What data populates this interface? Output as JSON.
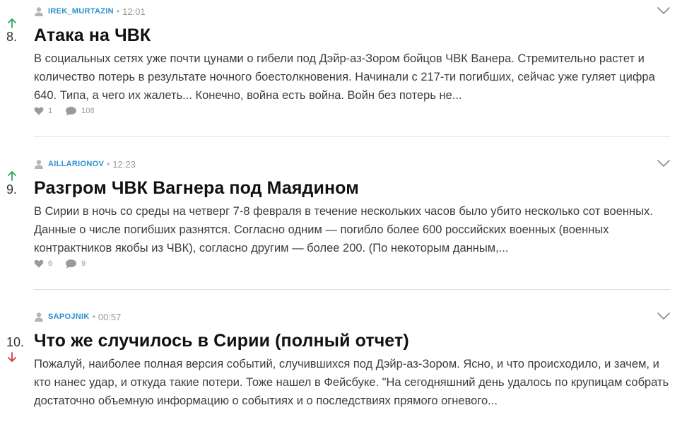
{
  "posts": [
    {
      "rank": "8.",
      "vote": "up",
      "author": "IREK_MURTAZIN",
      "time": "12:01",
      "title": "Атака на ЧВК",
      "excerpt": "В социальных сетях уже почти цунами о гибели под Дэйр-аз-Зором бойцов ЧВК Ванера. Стремительно растет и количество потерь в результате ночного боестолкновения. Начинали с 217-ти погибших, сейчас уже гуляет цифра 640. Типа, а чего их жалеть... Конечно, война есть война. Войн без потерь не...",
      "likes": "1",
      "comments": "108"
    },
    {
      "rank": "9.",
      "vote": "up",
      "author": "AILLARIONOV",
      "time": "12:23",
      "title": "Разгром ЧВК Вагнера под Маядином",
      "excerpt": "В Сирии в ночь со среды на четверг 7-8 февраля в течение нескольких часов было убито несколько сот военных. Данные о числе погибших разнятся. Согласно одним — погибло более 600 российских военных (военных контрактников якобы из ЧВК), согласно другим — более 200. (По некоторым данным,...",
      "likes": "6",
      "comments": "9"
    },
    {
      "rank": "10.",
      "vote": "down",
      "author": "SAPOJNIK",
      "time": "00:57",
      "title": "Что же случилось в Сирии (полный отчет)",
      "excerpt": "Пожалуй, наиболее полная версия событий, случившихся под Дэйр-аз-Зором. Ясно, и что происходило, и зачем, и кто нанес удар, и откуда такие потери. Тоже нашел в Фейсбуке. \"На сегодняшний день удалось по крупицам собрать достаточно объемную информацию о событиях и о последствиях прямого огневого...",
      "likes": "",
      "comments": ""
    }
  ],
  "meta_separator": "•",
  "icons": {
    "user": "user-icon",
    "heart": "heart-icon",
    "comment": "comment-icon",
    "chevron": "chevron-down-icon",
    "up": "arrow-up-icon",
    "down": "arrow-down-icon"
  },
  "colors": {
    "author": "#2b8fcf",
    "vote_up": "#2eaa5a",
    "vote_down": "#d9363e",
    "muted": "#999999"
  }
}
